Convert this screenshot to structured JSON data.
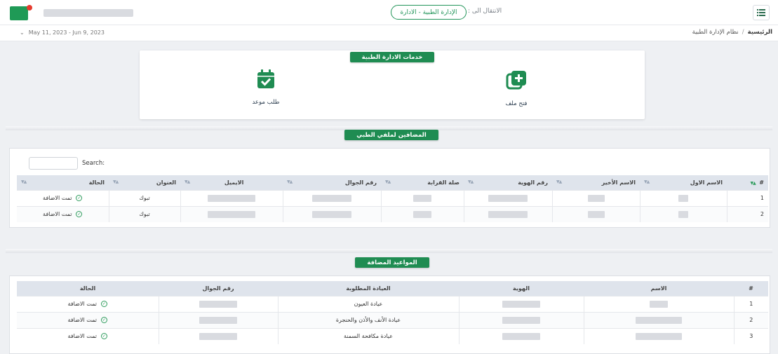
{
  "header": {
    "goto_label": "الانتقال الى :",
    "goto_value": "الإدارة الطبية - الادارة",
    "menu_icon": "list-icon"
  },
  "subbar": {
    "date_range": "May 11, 2023 - Jun 9, 2023",
    "breadcrumb_home": "الرئيسية",
    "breadcrumb_separator": "/",
    "breadcrumb_system": "نظام الإدارة الطبية"
  },
  "services": {
    "title": "خدمات الادارة الطبية",
    "items": [
      {
        "label": "فتح ملف",
        "icon": "add-file-icon"
      },
      {
        "label": "طلب موعد",
        "icon": "calendar-check-icon"
      }
    ]
  },
  "dependents": {
    "title": "المضافين لملفي الطبي",
    "search_label": "Search:",
    "columns": [
      "#",
      "الاسم الاول",
      "الاسم الأخير",
      "رقم الهوية",
      "صلة القرابة",
      "رقم الجوال",
      "الايميل",
      "العنوان",
      "الحالة"
    ],
    "rows": [
      {
        "num": "1",
        "city": "تبوك",
        "status": "تمت الاضافة"
      },
      {
        "num": "2",
        "city": "تبوك",
        "status": "تمت الاضافة"
      }
    ]
  },
  "appointments": {
    "title": "المواعيد المضافة",
    "columns": [
      "#",
      "الاسم",
      "الهوية",
      "العيادة المطلوبة",
      "رقم الجوال",
      "الحالة"
    ],
    "rows": [
      {
        "num": "1",
        "clinic": "عيادة العيون",
        "status": "تمت الاضافة"
      },
      {
        "num": "2",
        "clinic": "عيادة الأنف والأذن والحنجرة",
        "status": "تمت الاضافة"
      },
      {
        "num": "3",
        "clinic": "عيادة مكافحة السمنة",
        "status": "تمت الاضافة"
      }
    ]
  },
  "colors": {
    "brand_green": "#1f8c52",
    "logo_red": "#e63b2e",
    "header_row": "#dfe4ec"
  }
}
